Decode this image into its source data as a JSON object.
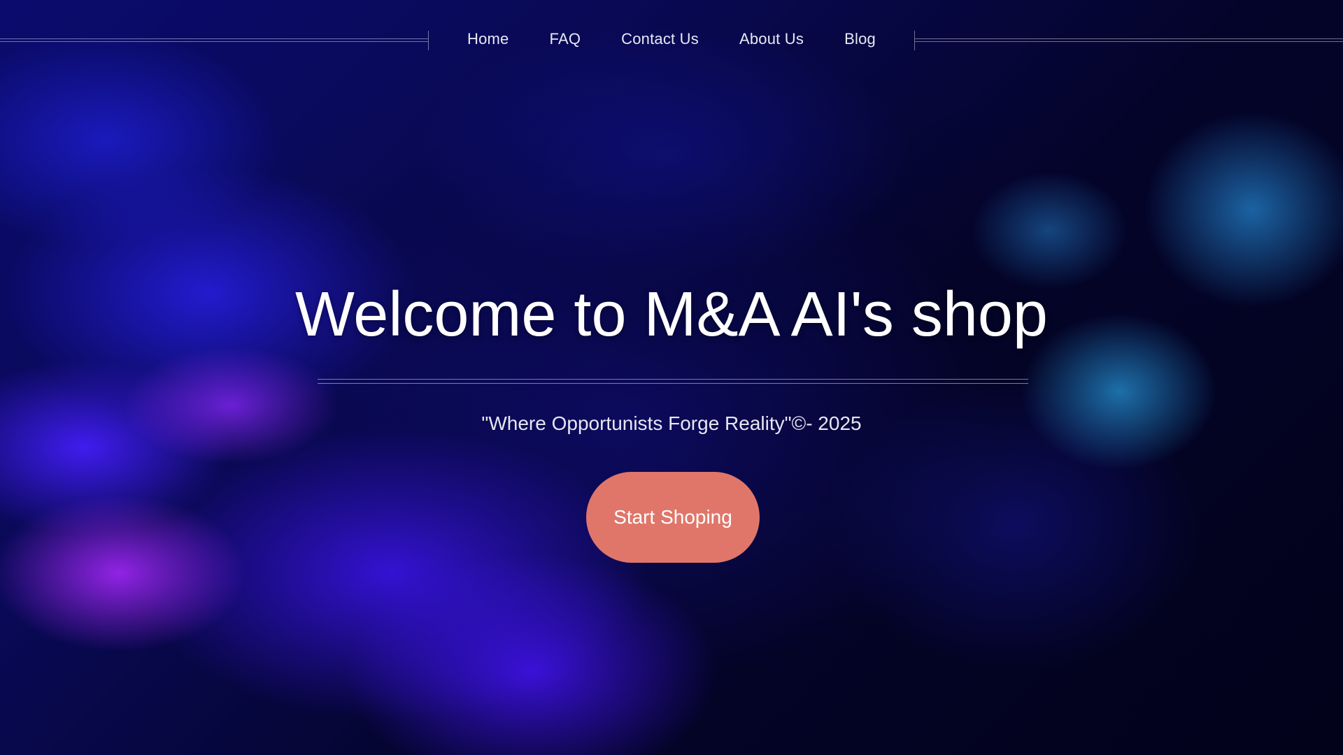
{
  "nav": {
    "items": [
      {
        "label": "Home"
      },
      {
        "label": "FAQ"
      },
      {
        "label": "Contact Us"
      },
      {
        "label": "About Us"
      },
      {
        "label": "Blog"
      }
    ]
  },
  "hero": {
    "headline": "Welcome to M&A AI's shop",
    "tagline": "\"Where Opportunists Forge Reality\"©- 2025",
    "cta_label": "Start Shoping"
  },
  "colors": {
    "cta_background": "#e0766a",
    "background_primary": "#0b0b6e",
    "text": "#ffffff"
  }
}
